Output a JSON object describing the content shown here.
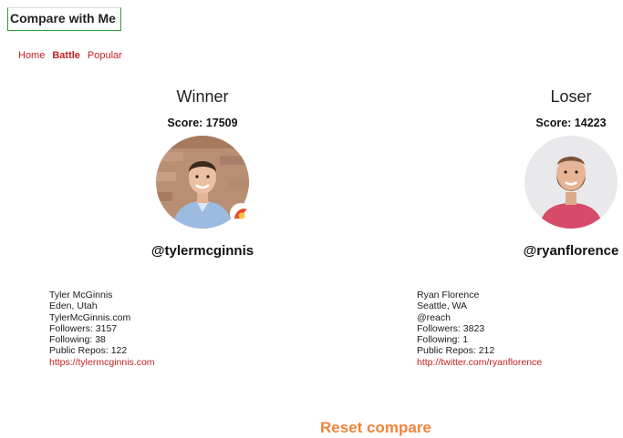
{
  "app": {
    "title": "Compare with Me"
  },
  "nav": {
    "items": [
      {
        "label": "Home",
        "active": false
      },
      {
        "label": "Battle",
        "active": true
      },
      {
        "label": "Popular",
        "active": false
      }
    ]
  },
  "winner": {
    "result": "Winner",
    "score": "Score: 17509",
    "handle": "@tylermcginnis",
    "info": {
      "name": "Tyler McGinnis",
      "location": "Eden, Utah",
      "company": "TylerMcGinnis.com",
      "followers": "Followers: 3157",
      "following": "Following: 38",
      "repos": "Public Repos: 122",
      "blog": "https://tylermcginnis.com"
    }
  },
  "loser": {
    "result": "Loser",
    "score": "Score: 14223",
    "handle": "@ryanflorence",
    "info": {
      "name": "Ryan Florence",
      "location": "Seattle, WA",
      "company": "@reach",
      "followers": "Followers: 3823",
      "following": "Following: 1",
      "repos": "Public Repos: 212",
      "blog": "http://twitter.com/ryanflorence"
    }
  },
  "reset": {
    "label": "Reset compare"
  },
  "colors": {
    "link": "#c41f1f",
    "reset": "#f0843a",
    "logo_border": "#2e9e3a"
  }
}
